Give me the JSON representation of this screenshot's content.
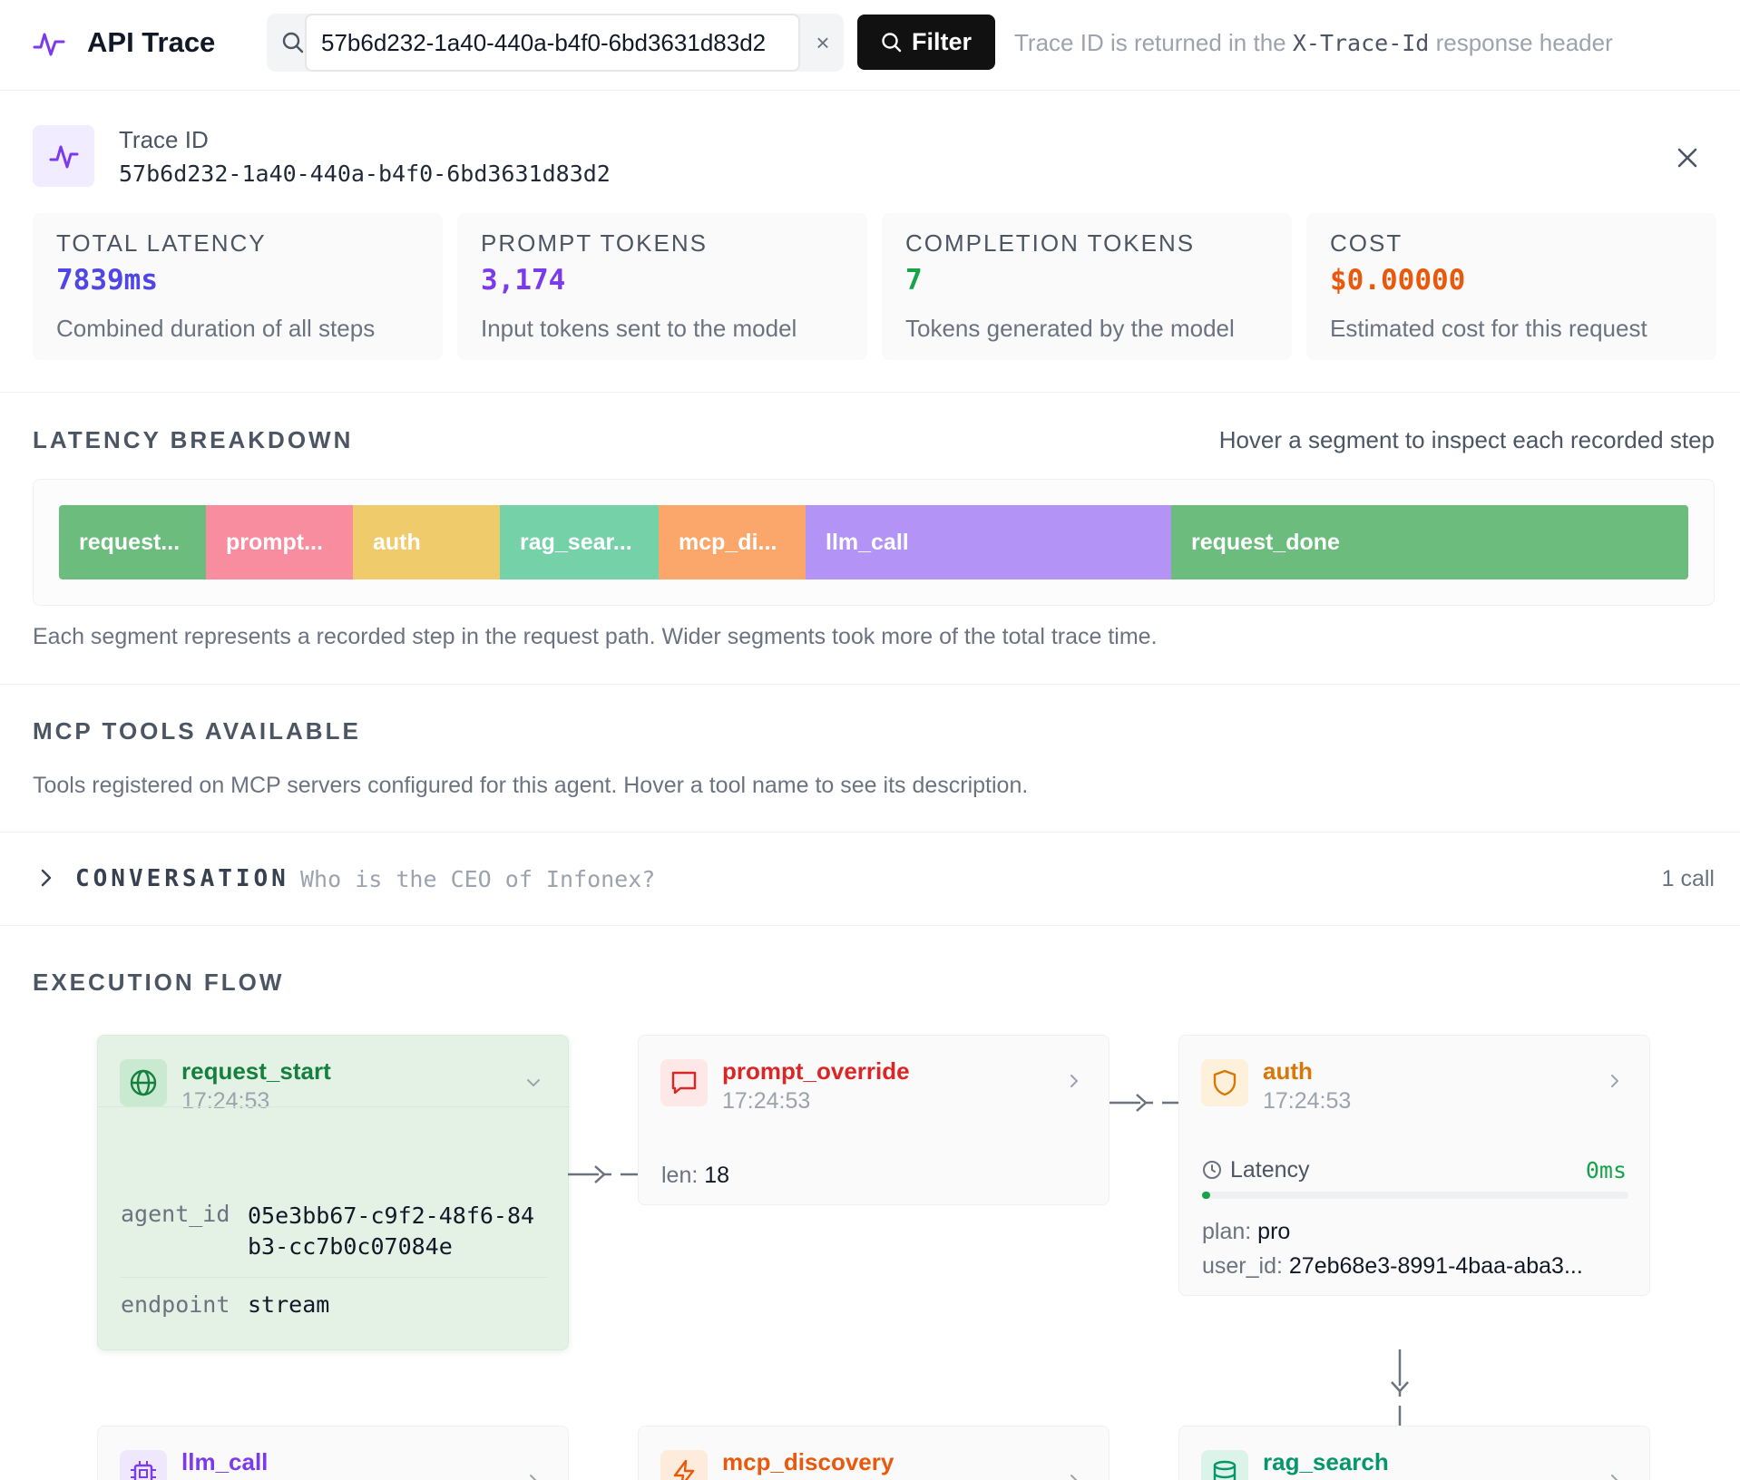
{
  "header": {
    "app_title": "API Trace",
    "search_value": "57b6d232-1a40-440a-b4f0-6bd3631d83d2",
    "clear_label": "×",
    "filter_label": "Filter",
    "hint_prefix": "Trace ID is returned in the",
    "hint_code": "X-Trace-Id",
    "hint_suffix": "response header"
  },
  "trace": {
    "label": "Trace ID",
    "id": "57b6d232-1a40-440a-b4f0-6bd3631d83d2"
  },
  "stats": [
    {
      "label": "TOTAL LATENCY",
      "value": "7839ms",
      "desc": "Combined duration of all steps",
      "color": "#4f46e5"
    },
    {
      "label": "PROMPT TOKENS",
      "value": "3,174",
      "desc": "Input tokens sent to the model",
      "color": "#7c3aed"
    },
    {
      "label": "COMPLETION TOKENS",
      "value": "7",
      "desc": "Tokens generated by the model",
      "color": "#16a34a"
    },
    {
      "label": "COST",
      "value": "$0.00000",
      "desc": "Estimated cost for this request",
      "color": "#ea580c"
    }
  ],
  "latency": {
    "title": "LATENCY BREAKDOWN",
    "hint": "Hover a segment to inspect each recorded step",
    "description": "Each segment represents a recorded step in the request path. Wider segments took more of the total trace time.",
    "segments": [
      {
        "label": "request...",
        "color": "#6cbd7d"
      },
      {
        "label": "prompt...",
        "color": "#f98da0"
      },
      {
        "label": "auth",
        "color": "#efcb6b"
      },
      {
        "label": "rag_sear...",
        "color": "#75d1a8"
      },
      {
        "label": "mcp_di...",
        "color": "#fba66a"
      },
      {
        "label": "llm_call",
        "color": "#b393f6"
      },
      {
        "label": "request_done",
        "color": "#6cbd7d"
      }
    ]
  },
  "mcp": {
    "title": "MCP TOOLS AVAILABLE",
    "description": "Tools registered on MCP servers configured for this agent. Hover a tool name to see its description."
  },
  "conversation": {
    "label": "CONVERSATION",
    "preview": "Who is the CEO of Infonex?",
    "count": "1 call"
  },
  "flow": {
    "title": "EXECUTION FLOW",
    "request_start": {
      "name": "request_start",
      "time": "17:24:53",
      "agent_id_label": "agent_id",
      "agent_id_line1": "05e3bb67-c9f2-48f6-84",
      "agent_id_line2": "b3-cc7b0c07084e",
      "endpoint_label": "endpoint",
      "endpoint_value": "stream",
      "color": "#15803d"
    },
    "prompt_override": {
      "name": "prompt_override",
      "time": "17:24:53",
      "len_label": "len:",
      "len_value": "18",
      "color": "#dc2626"
    },
    "auth": {
      "name": "auth",
      "time": "17:24:53",
      "latency_label": "Latency",
      "latency_value": "0ms",
      "latency_fraction": 0.02,
      "plan_label": "plan:",
      "plan_value": "pro",
      "user_label": "user_id:",
      "user_value": "27eb68e3-8991-4baa-aba3...",
      "color": "#d97706"
    },
    "llm_call": {
      "name": "llm_call",
      "color": "#7c3aed"
    },
    "mcp_discovery": {
      "name": "mcp_discovery",
      "color": "#ea580c"
    },
    "rag_search": {
      "name": "rag_search",
      "color": "#059669"
    }
  }
}
